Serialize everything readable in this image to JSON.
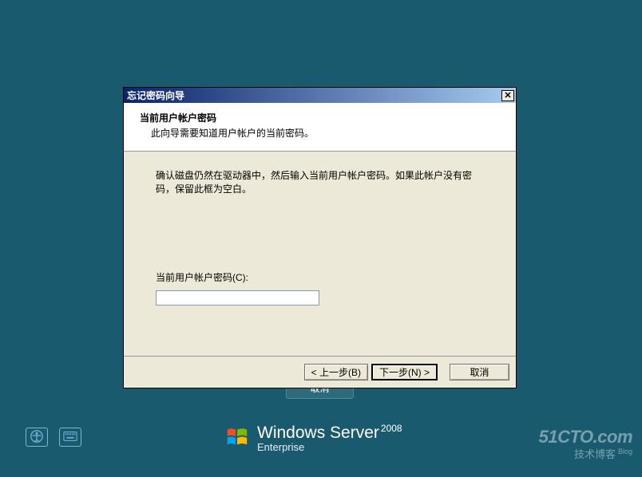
{
  "wizard": {
    "title": "忘记密码向导",
    "close_glyph": "✕",
    "header": {
      "title": "当前用户帐户密码",
      "sub": "此向导需要知道用户帐户的当前密码。"
    },
    "instruction": "确认磁盘仍然在驱动器中，然后输入当前用户帐户密码。如果此帐户没有密码，保留此框为空白。",
    "field_label": "当前用户帐户密码(C):",
    "field_value": "",
    "buttons": {
      "back": "< 上一步(B)",
      "next": "下一步(N) >",
      "cancel": "取消"
    }
  },
  "bg_cancel_label": "取消",
  "branding": {
    "line1": "Windows Server",
    "year": "2008",
    "line2": "Enterprise"
  },
  "watermark": {
    "site": "51CTO.com",
    "tag": "技术博客",
    "blog": "Blog"
  }
}
